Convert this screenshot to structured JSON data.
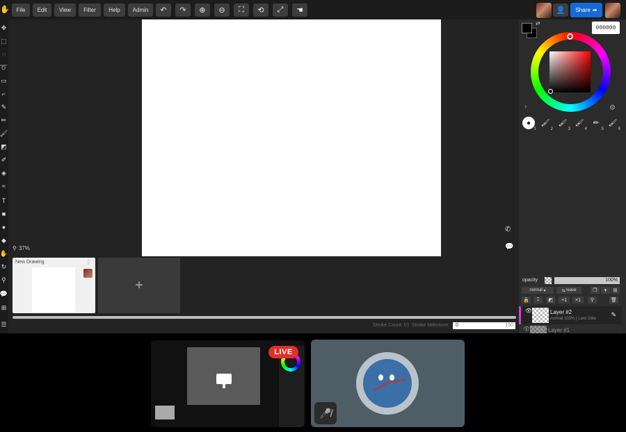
{
  "menu": {
    "file": "File",
    "edit": "Edit",
    "view": "View",
    "filter": "Filter",
    "help": "Help",
    "admin": "Admin"
  },
  "toolbar_icons": [
    "undo-icon",
    "redo-icon",
    "zoom-in-icon",
    "zoom-out-icon",
    "fit-icon",
    "rotate-icon",
    "fullscreen-icon",
    "hand-icon"
  ],
  "share": {
    "label": "Share"
  },
  "canvas": {
    "zoom": "37%"
  },
  "drawings": {
    "items": [
      {
        "title": "New Drawing"
      }
    ],
    "add_label": "+"
  },
  "status": {
    "stroke_count": "Stroke Count: 0",
    "stroke_milestone_label": "Stroke Milestone:",
    "milestone_value": "0",
    "milestone_max": "150"
  },
  "color": {
    "hex": "000000",
    "primary": "#000000",
    "secondary": "#000000",
    "hue": "#ff0000"
  },
  "brushes": [
    "1",
    "2",
    "3",
    "4",
    "5",
    "6"
  ],
  "layers_panel": {
    "opacity_label": "opacity",
    "opacity_value": "100%",
    "blend_mode": "normal",
    "leave_label": "leave",
    "layers": [
      {
        "name": "Layer #2",
        "meta": "normal 100% | Lord Glite"
      },
      {
        "name": "Layer #1",
        "meta": ""
      }
    ]
  },
  "meeting": {
    "live_label": "LIVE"
  }
}
